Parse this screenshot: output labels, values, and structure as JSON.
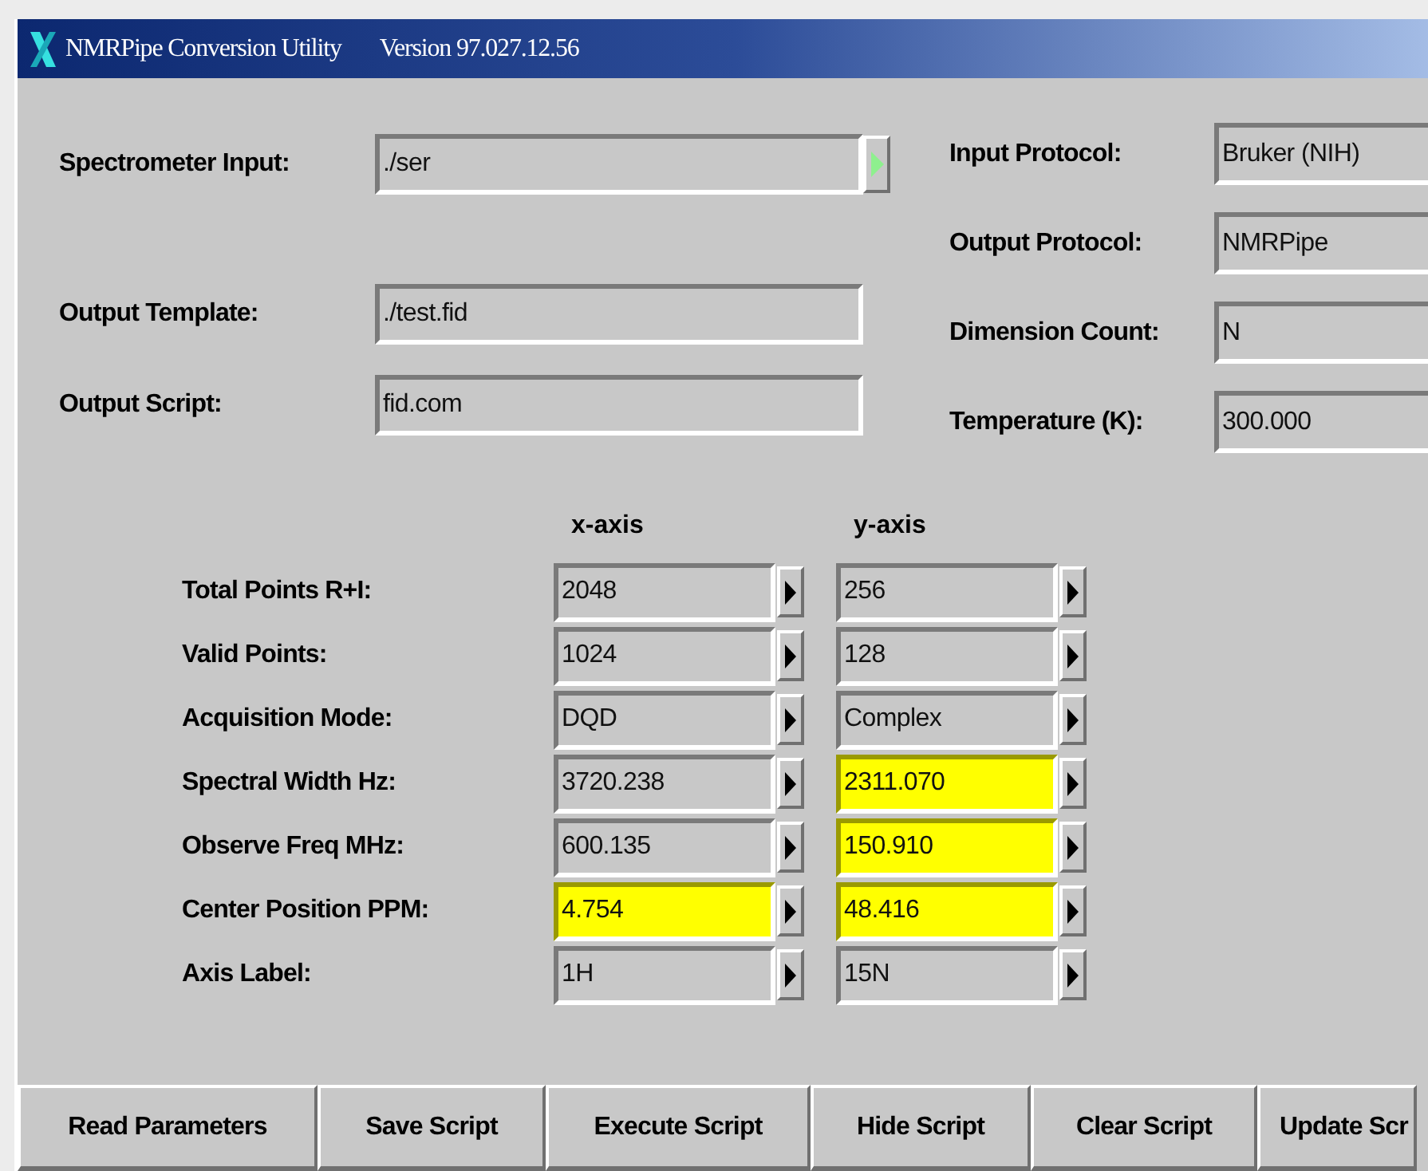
{
  "window": {
    "title": "NMRPipe Conversion Utility",
    "version": "Version 97.027.12.56"
  },
  "files": [
    {
      "label": "Spectrometer Input:",
      "value": "./ser",
      "kind": "browse"
    },
    {
      "label": "Output Template:",
      "value": "./test.fid",
      "kind": "text"
    },
    {
      "label": "Output Script:",
      "value": "fid.com",
      "kind": "text"
    }
  ],
  "settings": [
    {
      "label": "Input Protocol:",
      "value": "Bruker (NIH)"
    },
    {
      "label": "Output Protocol:",
      "value": "NMRPipe"
    },
    {
      "label": "Dimension Count:",
      "value": "N"
    },
    {
      "label": "Temperature (K):",
      "value": "300.000"
    }
  ],
  "axes": {
    "headers": [
      "x-axis",
      "y-axis"
    ],
    "rows": [
      {
        "label": "Total Points R+I:",
        "values": [
          {
            "value": "2048",
            "highlighted": false
          },
          {
            "value": "256",
            "highlighted": false
          }
        ]
      },
      {
        "label": "Valid Points:",
        "values": [
          {
            "value": "1024",
            "highlighted": false
          },
          {
            "value": "128",
            "highlighted": false
          }
        ]
      },
      {
        "label": "Acquisition Mode:",
        "values": [
          {
            "value": "DQD",
            "highlighted": false
          },
          {
            "value": "Complex",
            "highlighted": false
          }
        ]
      },
      {
        "label": "Spectral Width Hz:",
        "values": [
          {
            "value": "3720.238",
            "highlighted": false
          },
          {
            "value": "2311.070",
            "highlighted": true
          }
        ]
      },
      {
        "label": "Observe Freq MHz:",
        "values": [
          {
            "value": "600.135",
            "highlighted": false
          },
          {
            "value": "150.910",
            "highlighted": true
          }
        ]
      },
      {
        "label": "Center Position PPM:",
        "values": [
          {
            "value": "4.754",
            "highlighted": true
          },
          {
            "value": "48.416",
            "highlighted": true
          }
        ]
      },
      {
        "label": "Axis Label:",
        "values": [
          {
            "value": "1H",
            "highlighted": false
          },
          {
            "value": "15N",
            "highlighted": false
          }
        ]
      }
    ]
  },
  "buttons": [
    "Read Parameters",
    "Save Script",
    "Execute Script",
    "Hide Script",
    "Clear Script",
    "Update Scr"
  ]
}
